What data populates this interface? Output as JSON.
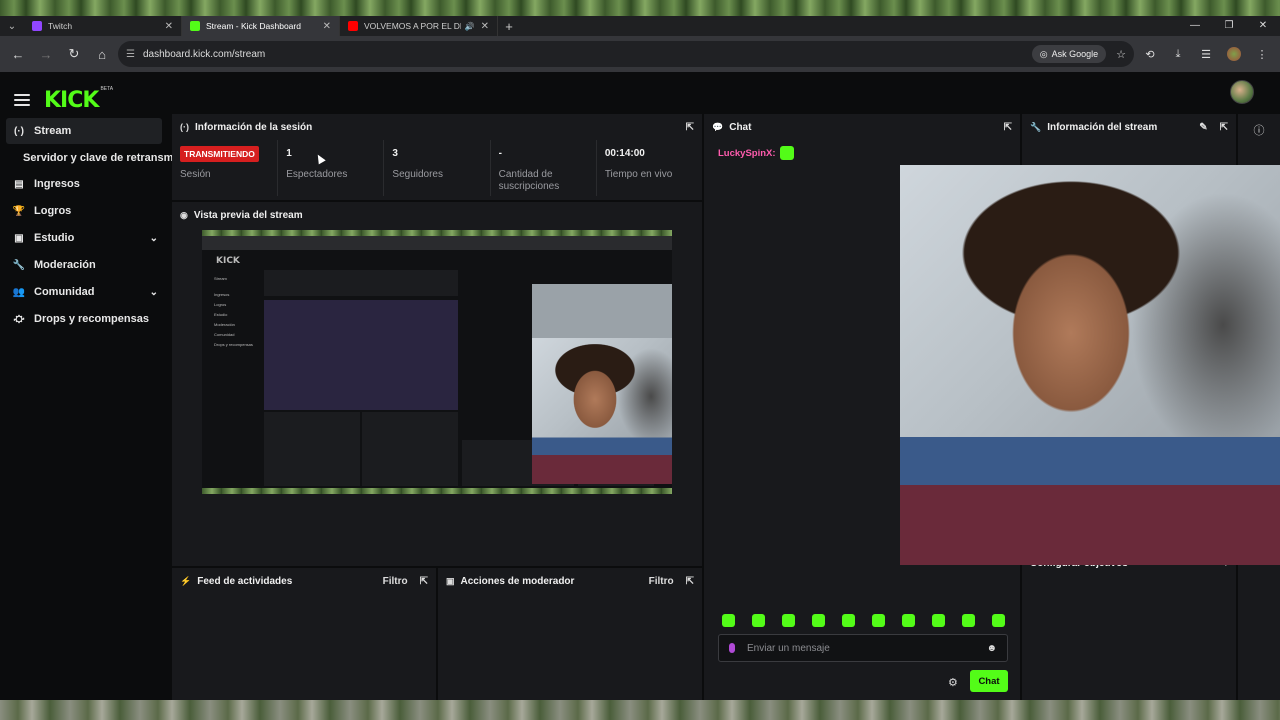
{
  "browser": {
    "tabs": [
      {
        "title": "Twitch",
        "favicon_color": "#9146ff"
      },
      {
        "title": "Stream - Kick Dashboard",
        "favicon_color": "#53fc18",
        "active": true
      },
      {
        "title": "VOLVEMOS A POR EL DRAGÓ",
        "favicon_color": "#ff0000"
      }
    ],
    "url": "dashboard.kick.com/stream",
    "ask_google": "Ask Google"
  },
  "app": {
    "logo": "KICK",
    "logo_badge": "BETA"
  },
  "sidebar": {
    "items": [
      {
        "label": "Stream",
        "icon": "broadcast-icon",
        "glyph": "(·)",
        "active": true
      },
      {
        "label": "Servidor y clave de retransmisión",
        "sub": true
      },
      {
        "label": "Ingresos",
        "icon": "chart-icon",
        "glyph": "▤"
      },
      {
        "label": "Logros",
        "icon": "trophy-icon",
        "glyph": "🏆"
      },
      {
        "label": "Estudio",
        "icon": "layout-icon",
        "glyph": "▣",
        "chevron": true
      },
      {
        "label": "Moderación",
        "icon": "wrench-icon",
        "glyph": "🔧"
      },
      {
        "label": "Comunidad",
        "icon": "people-icon",
        "glyph": "👥",
        "chevron": true
      },
      {
        "label": "Drops y recompensas",
        "icon": "gift-icon",
        "glyph": "⛮"
      }
    ]
  },
  "session": {
    "title": "Información de la sesión",
    "live_badge": "TRANSMITIENDO",
    "stats": [
      {
        "value": "",
        "label": "Sesión"
      },
      {
        "value": "1",
        "label": "Espectadores"
      },
      {
        "value": "3",
        "label": "Seguidores"
      },
      {
        "value": "-",
        "label": "Cantidad de suscripciones"
      },
      {
        "value": "00:14:00",
        "label": "Tiempo en vivo"
      }
    ]
  },
  "preview": {
    "title": "Vista previa del stream"
  },
  "activity_feed": {
    "title": "Feed de actividades",
    "filter": "Filtro"
  },
  "mod_actions": {
    "title": "Acciones de moderador",
    "filter": "Filtro"
  },
  "chat": {
    "title": "Chat",
    "messages": [
      {
        "user": "LuckySpinX:"
      }
    ],
    "placeholder": "Enviar un mensaje",
    "send_label": "Chat"
  },
  "stream_info": {
    "title": "Información del stream",
    "goals": "Configurar objetivos"
  }
}
